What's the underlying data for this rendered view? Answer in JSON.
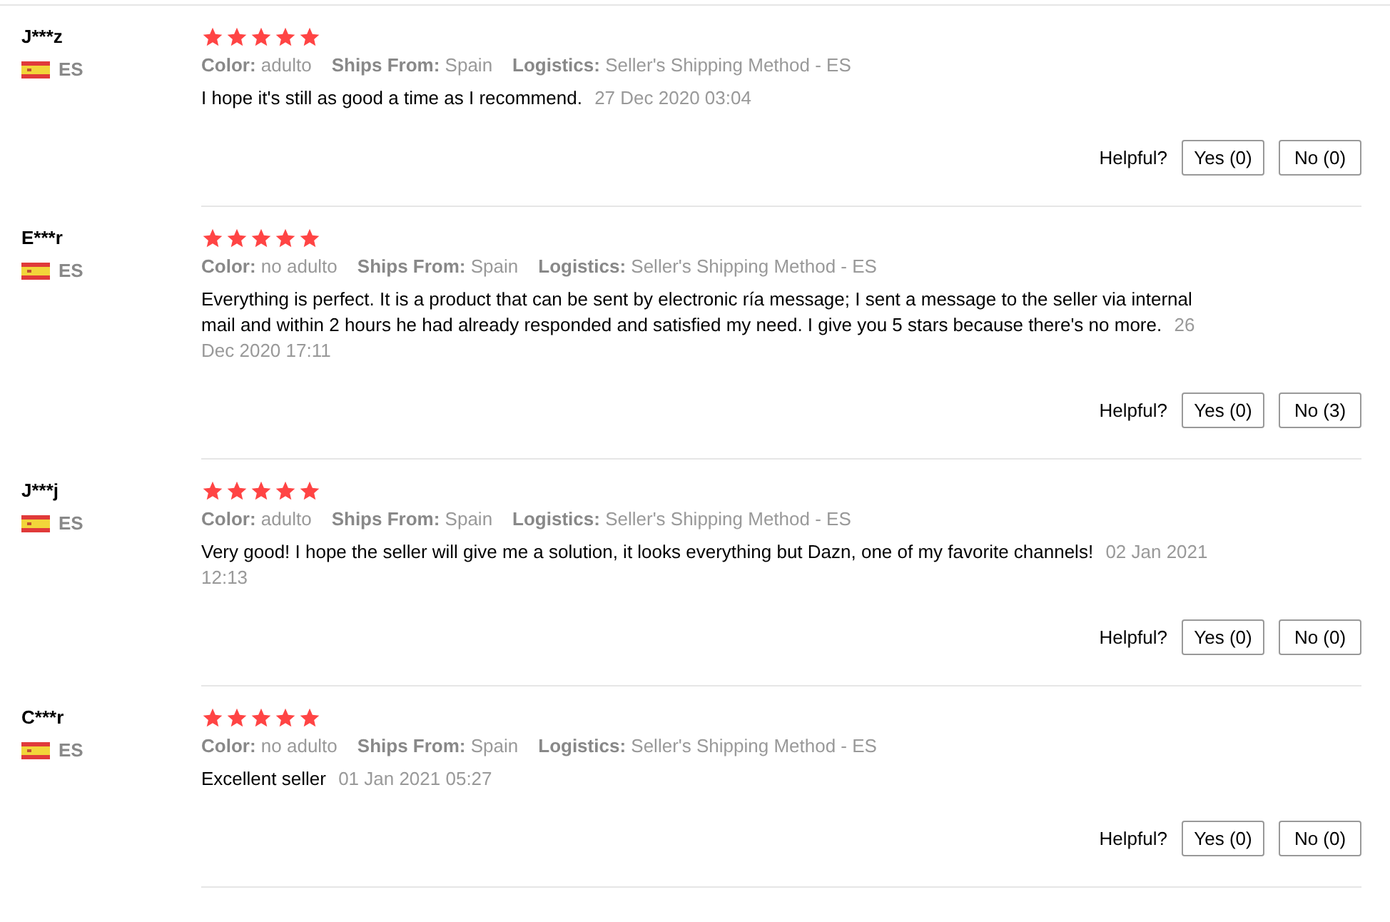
{
  "reviews": [
    {
      "user": "J***z",
      "country": "ES",
      "stars": 5,
      "attributes": [
        {
          "label": "Color:",
          "value": "adulto"
        },
        {
          "label": "Ships From:",
          "value": "Spain"
        },
        {
          "label": "Logistics:",
          "value": "Seller's Shipping Method - ES"
        }
      ],
      "text": "I hope it's still as good a time as I recommend.",
      "date": "27 Dec 2020 03:04",
      "helpful_label": "Helpful?",
      "yes": "Yes (0)",
      "no": "No (0)"
    },
    {
      "user": "E***r",
      "country": "ES",
      "stars": 5,
      "attributes": [
        {
          "label": "Color:",
          "value": "no adulto"
        },
        {
          "label": "Ships From:",
          "value": "Spain"
        },
        {
          "label": "Logistics:",
          "value": "Seller's Shipping Method - ES"
        }
      ],
      "text": "Everything is perfect. It is a product that can be sent by electronic ría message; I sent a message to the seller via internal mail and within 2 hours he had already responded and satisfied my need. I give you 5 stars because there's no more.",
      "date": "26 Dec 2020 17:11",
      "helpful_label": "Helpful?",
      "yes": "Yes (0)",
      "no": "No (3)"
    },
    {
      "user": "J***j",
      "country": "ES",
      "stars": 5,
      "attributes": [
        {
          "label": "Color:",
          "value": "adulto"
        },
        {
          "label": "Ships From:",
          "value": "Spain"
        },
        {
          "label": "Logistics:",
          "value": "Seller's Shipping Method - ES"
        }
      ],
      "text": "Very good! I hope the seller will give me a solution, it looks everything but Dazn, one of my favorite channels!",
      "date": "02 Jan 2021 12:13",
      "helpful_label": "Helpful?",
      "yes": "Yes (0)",
      "no": "No (0)"
    },
    {
      "user": "C***r",
      "country": "ES",
      "stars": 5,
      "attributes": [
        {
          "label": "Color:",
          "value": "no adulto"
        },
        {
          "label": "Ships From:",
          "value": "Spain"
        },
        {
          "label": "Logistics:",
          "value": "Seller's Shipping Method - ES"
        }
      ],
      "text": "Excellent seller",
      "date": "01 Jan 2021 05:27",
      "helpful_label": "Helpful?",
      "yes": "Yes (0)",
      "no": "No (0)"
    }
  ]
}
